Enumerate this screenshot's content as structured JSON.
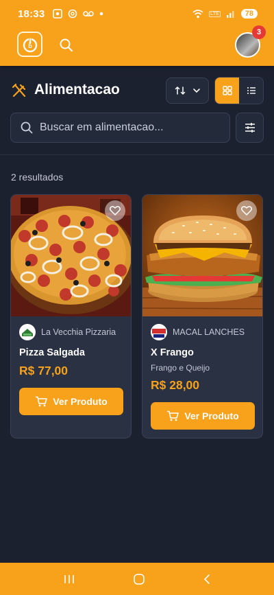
{
  "status_bar": {
    "time": "18:33",
    "battery": "78",
    "network": "LTE"
  },
  "header": {
    "notification_count": "3"
  },
  "page": {
    "title": "Alimentacao",
    "search_placeholder": "Buscar em alimentacao...",
    "results_count": "2 resultados"
  },
  "products": [
    {
      "store_name": "La Vecchia Pizzaria",
      "name": "Pizza Salgada",
      "description": "",
      "price": "R$ 77,00",
      "button_label": "Ver Produto",
      "image": "pizza",
      "store_logo": "green-house-logo"
    },
    {
      "store_name": "MACAL LANCHES",
      "name": "X Frango",
      "description": "Frango e Queijo",
      "price": "R$ 28,00",
      "button_label": "Ver Produto",
      "image": "burger",
      "store_logo": "macal-logo"
    }
  ],
  "colors": {
    "accent": "#f8a11b",
    "background": "#1c2130",
    "card": "#2a3142",
    "badge": "#e53935"
  }
}
